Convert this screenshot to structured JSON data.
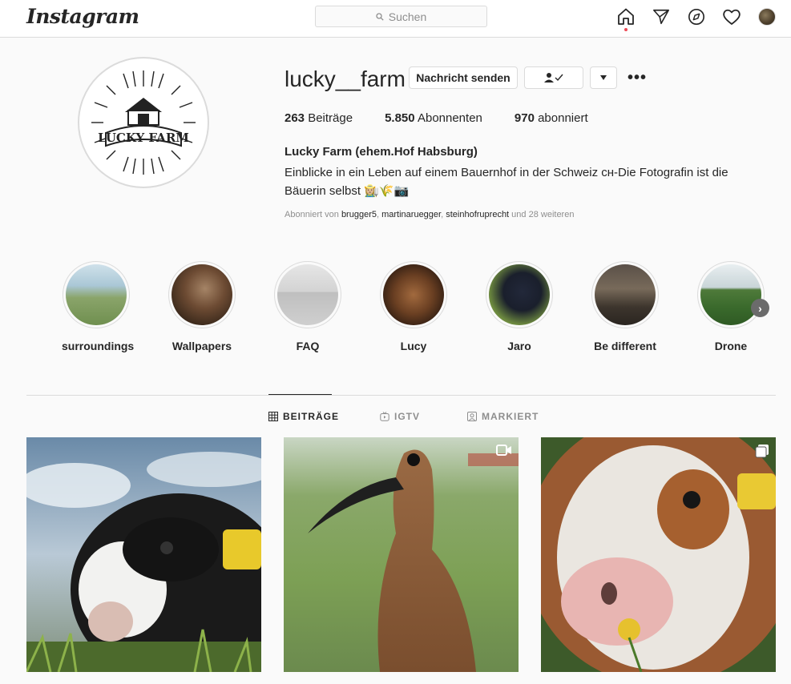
{
  "nav": {
    "logo": "Instagram",
    "search_placeholder": "Suchen",
    "icons": [
      "home-icon",
      "direct-icon",
      "explore-icon",
      "activity-icon",
      "avatar"
    ]
  },
  "profile": {
    "username": "lucky__farm",
    "message_button": "Nachricht senden",
    "stats": [
      {
        "count": "263",
        "label": "Beiträge"
      },
      {
        "count": "5.850",
        "label": "Abonnenten"
      },
      {
        "count": "970",
        "label": "abonniert"
      }
    ],
    "full_name": "Lucky Farm (ehem.Hof Habsburg)",
    "bio_line1": "Einblicke in ein Leben auf einem Bauernhof in der Schweiz ᴄʜ-Die Fotografin ist die",
    "bio_line2": "Bäuerin selbst 👩🏼‍🌾🌾📷",
    "followed_prefix": "Abonniert von ",
    "followed_by": [
      "brugger5",
      "martinaruegger",
      "steinhofruprecht"
    ],
    "followed_suffix": " und 28 weiteren"
  },
  "highlights": [
    {
      "label": "surroundings"
    },
    {
      "label": "Wallpapers"
    },
    {
      "label": "FAQ"
    },
    {
      "label": "Lucy"
    },
    {
      "label": "Jaro"
    },
    {
      "label": "Be different"
    },
    {
      "label": "Drone"
    }
  ],
  "tabs": [
    {
      "label": "BEITRÄGE",
      "active": true
    },
    {
      "label": "IGTV",
      "active": false
    },
    {
      "label": "MARKIERT",
      "active": false
    }
  ],
  "colors": {
    "border": "#dbdbdb",
    "background": "#fafafa",
    "text": "#262626",
    "muted": "#8e8e8e",
    "notification": "#ed4956"
  }
}
